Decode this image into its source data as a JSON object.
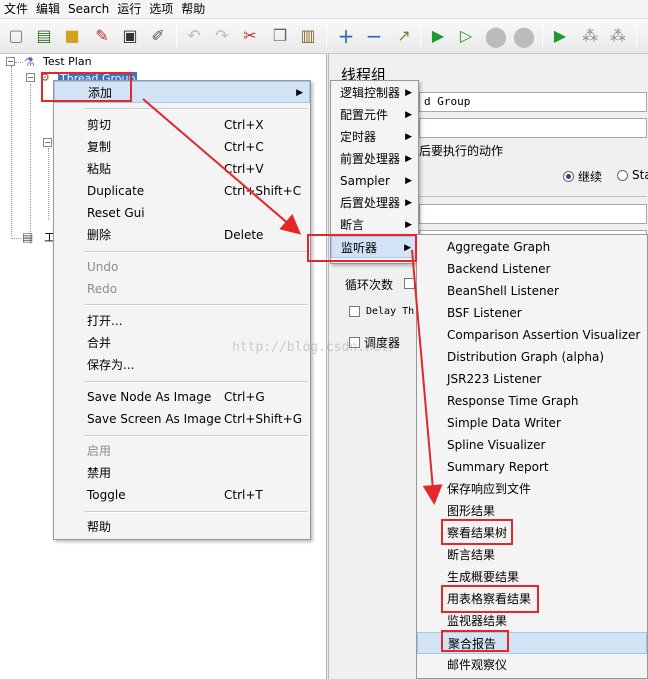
{
  "menubar": [
    "文件",
    "编辑",
    "Search",
    "运行",
    "选项",
    "帮助"
  ],
  "tree": {
    "root": "Test Plan",
    "thread_group": "Thread Group",
    "workbench_fragment": "工"
  },
  "right_panel": {
    "title": "线程组",
    "name_value": "d Group",
    "action_label": "后要执行的动作",
    "continue_label": "继续",
    "start_label": "Sta",
    "loop_label": "循环次数",
    "delay_label": "Delay Th",
    "scheduler_label": "调度器"
  },
  "context_menu": {
    "add": "添加",
    "cut": "剪切",
    "cut_key": "Ctrl+X",
    "copy": "复制",
    "copy_key": "Ctrl+C",
    "paste": "粘贴",
    "paste_key": "Ctrl+V",
    "duplicate": "Duplicate",
    "duplicate_key": "Ctrl+Shift+C",
    "reset_gui": "Reset Gui",
    "delete": "删除",
    "delete_key": "Delete",
    "undo": "Undo",
    "redo": "Redo",
    "open": "打开...",
    "merge": "合并",
    "save_as": "保存为...",
    "save_node_image": "Save Node As Image",
    "save_node_image_key": "Ctrl+G",
    "save_screen_image": "Save Screen As Image",
    "save_screen_image_key": "Ctrl+Shift+G",
    "enable": "启用",
    "disable": "禁用",
    "toggle": "Toggle",
    "toggle_key": "Ctrl+T",
    "help": "帮助"
  },
  "add_submenu": [
    "逻辑控制器",
    "配置元件",
    "定时器",
    "前置处理器",
    "Sampler",
    "后置处理器",
    "断言",
    "监听器"
  ],
  "listener_submenu": [
    "Aggregate Graph",
    "Backend Listener",
    "BeanShell Listener",
    "BSF Listener",
    "Comparison Assertion Visualizer",
    "Distribution Graph (alpha)",
    "JSR223 Listener",
    "Response Time Graph",
    "Simple Data Writer",
    "Spline Visualizer",
    "Summary Report",
    "保存响应到文件",
    "图形结果",
    "察看结果树",
    "断言结果",
    "生成概要结果",
    "用表格察看结果",
    "监视器结果",
    "聚合报告",
    "邮件观察仪"
  ],
  "watermark": "http://blog.csdn.net/",
  "colors": {
    "highlight_box": "#e3272b",
    "selection": "#3b72c6",
    "menu_hover": "#d2e3f6"
  }
}
